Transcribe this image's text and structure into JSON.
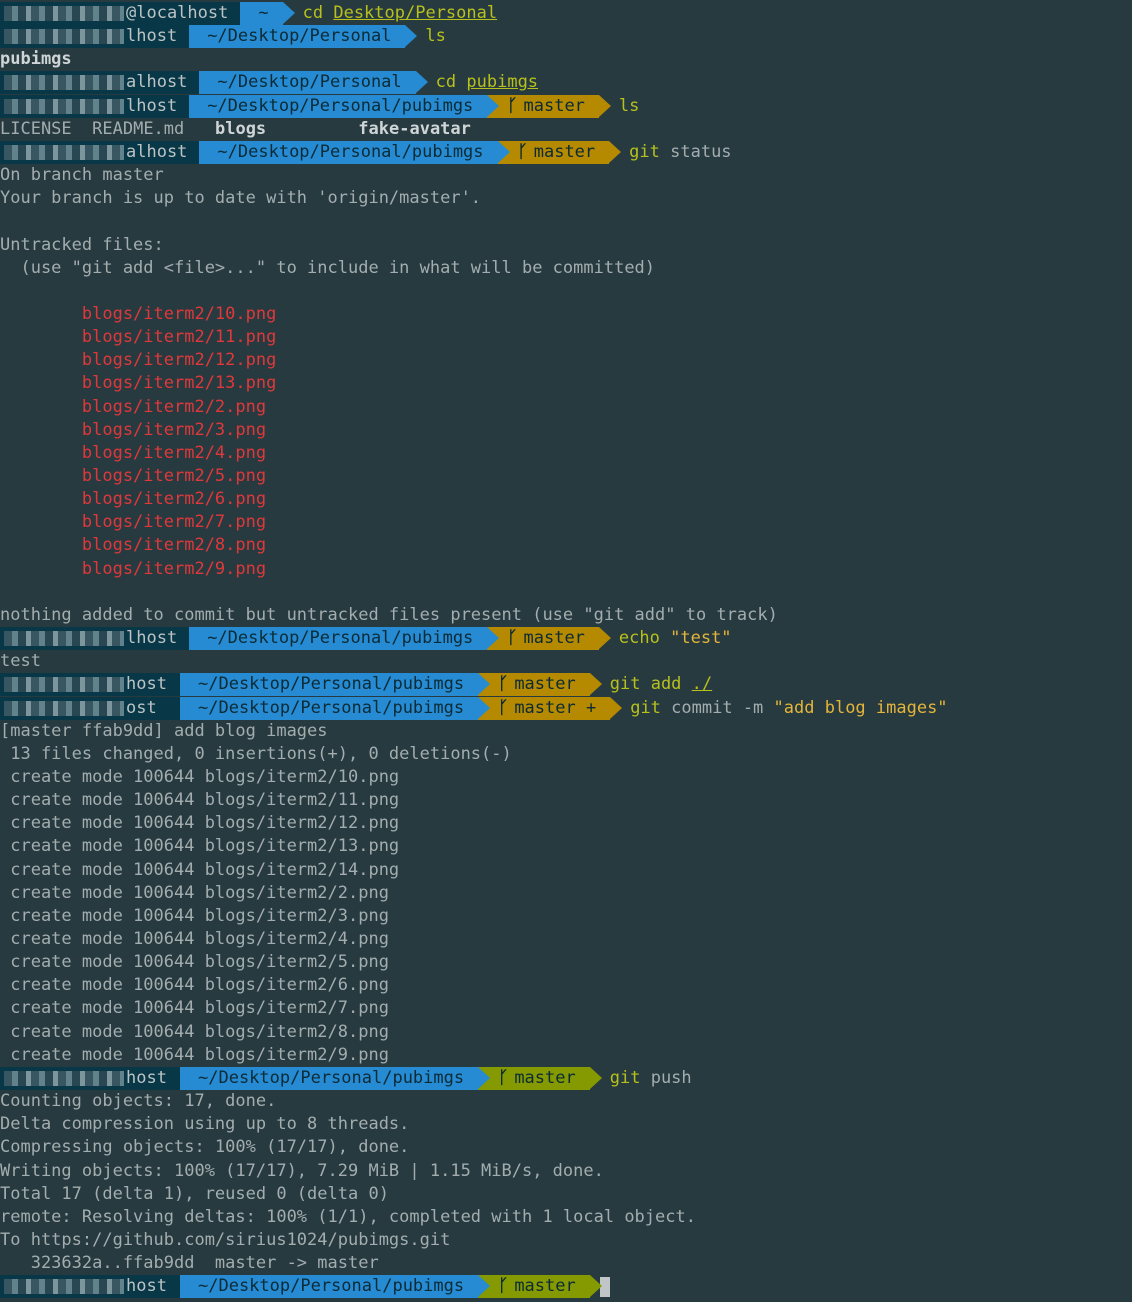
{
  "prompt": {
    "host_suffix_1": "@localhost",
    "host_suffix_2": "lhost",
    "host_suffix_3": "alhost",
    "host_suffix_4": "lhost",
    "host_suffix_5": "host",
    "host_suffix_6": "ost",
    "home_dir": "~",
    "dir_personal": "~/Desktop/Personal",
    "dir_pubimgs": "~/Desktop/Personal/pubimgs",
    "branch": "master",
    "branch_dirty": "master +",
    "branch_icon": "branch-icon"
  },
  "commands": {
    "cd_personal_kw": "cd",
    "cd_personal_arg": "Desktop/Personal",
    "ls": "ls",
    "cd_pubimgs_kw": "cd",
    "cd_pubimgs_arg": "pubimgs",
    "git_status_kw": "git",
    "git_status_arg": "status",
    "echo_kw": "echo",
    "echo_arg": "\"test\"",
    "git_add_kw": "git",
    "git_add_sub": "add",
    "git_add_arg": "./",
    "git_commit_kw": "git",
    "git_commit_sub": "commit -m",
    "git_commit_arg": "\"add blog images\"",
    "git_push_kw": "git",
    "git_push_sub": "push"
  },
  "outputs": {
    "ls1": "pubimgs",
    "ls2_license": "LICENSE",
    "ls2_readme": "README.md",
    "ls2_blogs": "blogs",
    "ls2_fake": "fake-avatar",
    "status": [
      "On branch master",
      "Your branch is up to date with 'origin/master'.",
      "",
      "Untracked files:",
      "  (use \"git add <file>...\" to include in what will be committed)"
    ],
    "untracked": [
      "blogs/iterm2/10.png",
      "blogs/iterm2/11.png",
      "blogs/iterm2/12.png",
      "blogs/iterm2/13.png",
      "blogs/iterm2/2.png",
      "blogs/iterm2/3.png",
      "blogs/iterm2/4.png",
      "blogs/iterm2/5.png",
      "blogs/iterm2/6.png",
      "blogs/iterm2/7.png",
      "blogs/iterm2/8.png",
      "blogs/iterm2/9.png"
    ],
    "nothing_added": "nothing added to commit but untracked files present (use \"git add\" to track)",
    "echo_out": "test",
    "commit": [
      "[master ffab9dd] add blog images",
      " 13 files changed, 0 insertions(+), 0 deletions(-)",
      " create mode 100644 blogs/iterm2/10.png",
      " create mode 100644 blogs/iterm2/11.png",
      " create mode 100644 blogs/iterm2/12.png",
      " create mode 100644 blogs/iterm2/13.png",
      " create mode 100644 blogs/iterm2/14.png",
      " create mode 100644 blogs/iterm2/2.png",
      " create mode 100644 blogs/iterm2/3.png",
      " create mode 100644 blogs/iterm2/4.png",
      " create mode 100644 blogs/iterm2/5.png",
      " create mode 100644 blogs/iterm2/6.png",
      " create mode 100644 blogs/iterm2/7.png",
      " create mode 100644 blogs/iterm2/8.png",
      " create mode 100644 blogs/iterm2/9.png"
    ],
    "push": [
      "Counting objects: 17, done.",
      "Delta compression using up to 8 threads.",
      "Compressing objects: 100% (17/17), done.",
      "Writing objects: 100% (17/17), 7.29 MiB | 1.15 MiB/s, done.",
      "Total 17 (delta 1), reused 0 (delta 0)",
      "remote: Resolving deltas: 100% (1/1), completed with 1 local object.",
      "To https://github.com/sirius1024/pubimgs.git",
      "   323632a..ffab9dd  master -> master"
    ]
  },
  "colors": {
    "background": "#263a40",
    "host_bg": "#083847",
    "dir_bg": "#268bd2",
    "git_clean_bg": "#859900",
    "git_dirty_bg": "#b58900",
    "untracked_fg": "#e0383a"
  }
}
